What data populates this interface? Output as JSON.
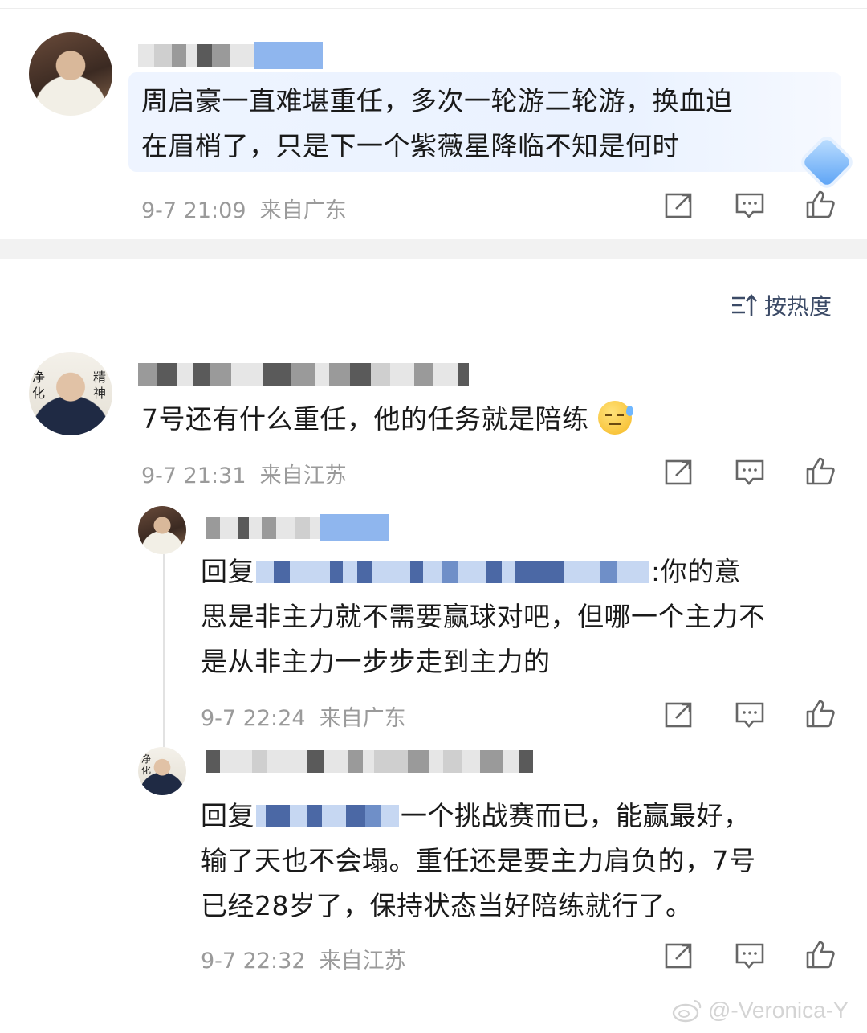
{
  "comments": [
    {
      "text_line1": "周启豪一直难堪重任，多次一轮游二轮游，换血迫",
      "text_line2": "在眉梢了，只是下一个紫薇星降临不知是何时",
      "time": "9-7 21:09",
      "location": "来自广东"
    },
    {
      "avatar_left": "净化",
      "avatar_right": "精神",
      "text": "7号还有什么重任，他的任务就是陪练",
      "emoji": "sweat-face-emoji",
      "time": "9-7 21:31",
      "location": "来自江苏",
      "replies": [
        {
          "reply_prefix": "回复",
          "text_after_mention": ":你的意",
          "text_line2": "思是非主力就不需要赢球对吧，但哪一个主力不",
          "text_line3": "是从非主力一步步走到主力的",
          "time": "9-7 22:24",
          "location": "来自广东"
        },
        {
          "avatar_label": "净化",
          "reply_prefix": "回复",
          "text_after_mention": "一个挑战赛而已，能赢最好，",
          "text_line2": "输了天也不会塌。重任还是要主力肩负的，7号",
          "text_line3": "已经28岁了，保持状态当好陪练就行了。",
          "time": "9-7 22:32",
          "location": "来自江苏"
        }
      ]
    }
  ],
  "sort": {
    "label": "按热度",
    "icon": "sort-icon"
  },
  "actions": {
    "share": "share-icon",
    "comment": "comment-icon",
    "like": "like-icon"
  },
  "watermark": {
    "text": "@-Veronica-Y",
    "icon": "weibo-icon"
  }
}
